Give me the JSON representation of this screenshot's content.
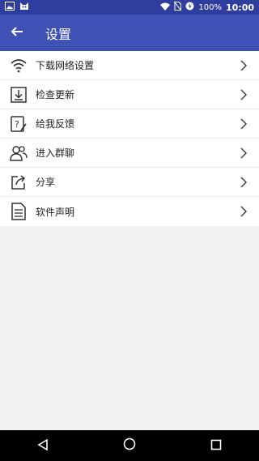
{
  "status_bar": {
    "battery_percent": "100%",
    "time": "10:00"
  },
  "app_bar": {
    "title": "设置",
    "back_icon": "arrow-left-icon"
  },
  "menu": {
    "items": [
      {
        "label": "下载网络设置",
        "icon": "wifi-icon"
      },
      {
        "label": "检查更新",
        "icon": "download-update-icon"
      },
      {
        "label": "给我反馈",
        "icon": "feedback-icon"
      },
      {
        "label": "进入群聊",
        "icon": "group-chat-icon"
      },
      {
        "label": "分享",
        "icon": "share-icon"
      },
      {
        "label": "软件声明",
        "icon": "document-icon"
      }
    ]
  },
  "colors": {
    "primary": "#3f51b5",
    "primary_dark": "#2f3e9e",
    "background": "#f2f2f2"
  }
}
